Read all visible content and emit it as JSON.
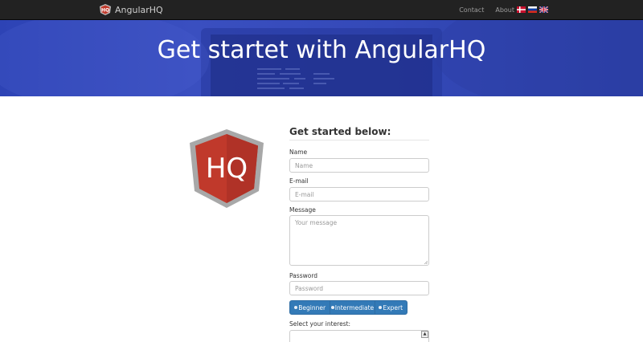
{
  "navbar": {
    "brand": "AngularHQ",
    "links": [
      "Contact",
      "About"
    ],
    "flags": [
      "danish-flag-icon",
      "russian-flag-icon",
      "english-flag-icon"
    ]
  },
  "hero": {
    "title": "Get startet with AngularHQ"
  },
  "logo": {
    "text": "HQ"
  },
  "form": {
    "heading": "Get started below:",
    "name": {
      "label": "Name",
      "placeholder": "Name",
      "value": ""
    },
    "email": {
      "label": "E-mail",
      "placeholder": "E-mail",
      "value": ""
    },
    "message": {
      "label": "Message",
      "placeholder": "Your message",
      "value": ""
    },
    "password": {
      "label": "Password",
      "placeholder": "Password",
      "value": ""
    },
    "levels": [
      "Beginner",
      "Intermediate",
      "Expert"
    ],
    "interest": {
      "label": "Select your interest:",
      "value": ""
    }
  },
  "colors": {
    "navbar_bg": "#222222",
    "hero_bg": "#3449b8",
    "brand_red": "#c0392b",
    "primary_button": "#337ab7"
  }
}
